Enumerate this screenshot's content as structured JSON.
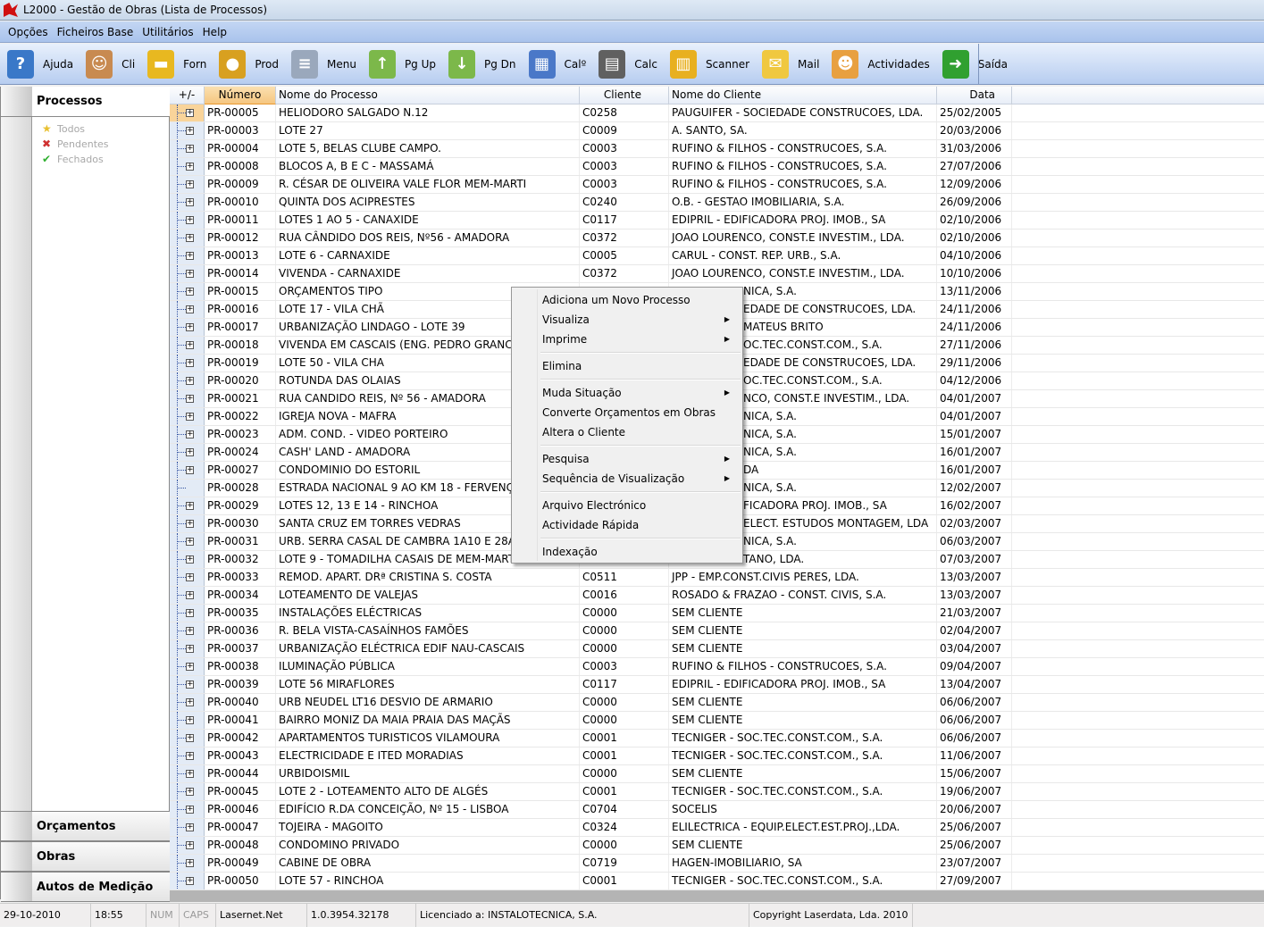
{
  "window": {
    "title": "L2000 - Gestão de Obras (Lista de Processos)"
  },
  "menu": [
    "Opções",
    "Ficheiros Base",
    "Utilitários",
    "Help"
  ],
  "toolbar": [
    {
      "label": "Ajuda",
      "icon": "help-book-icon",
      "color": "#3a78c8"
    },
    {
      "label": "Cli",
      "icon": "clients-icon",
      "color": "#c88a50"
    },
    {
      "label": "Forn",
      "icon": "truck-icon",
      "color": "#e8b820"
    },
    {
      "label": "Prod",
      "icon": "product-icon",
      "color": "#d8a020"
    },
    {
      "label": "Menu",
      "icon": "menu-document-icon",
      "color": "#9aa8bc"
    },
    {
      "label": "Pg Up",
      "icon": "page-up-icon",
      "color": "#7cb84a"
    },
    {
      "label": "Pg Dn",
      "icon": "page-down-icon",
      "color": "#7cb84a"
    },
    {
      "label": "Calº",
      "icon": "calendar-icon",
      "color": "#4a78c8"
    },
    {
      "label": "Calc",
      "icon": "calculator-icon",
      "color": "#606060"
    },
    {
      "label": "Scanner",
      "icon": "file-cabinet-icon",
      "color": "#e8b020"
    },
    {
      "label": "Mail",
      "icon": "mail-icon",
      "color": "#f0c840"
    },
    {
      "label": "Actividades",
      "icon": "worker-icon",
      "color": "#e8a040"
    },
    {
      "label": "Saída",
      "icon": "exit-door-icon",
      "color": "#30a030"
    }
  ],
  "sidebar": {
    "title": "Processos",
    "filters": [
      {
        "label": "Todos",
        "icon": "star-icon",
        "color": "#e8c030"
      },
      {
        "label": "Pendentes",
        "icon": "x-icon",
        "color": "#d03030"
      },
      {
        "label": "Fechados",
        "icon": "check-icon",
        "color": "#30b030"
      }
    ],
    "sections": [
      "Orçamentos",
      "Obras",
      "Autos de Medição"
    ]
  },
  "grid": {
    "columns": [
      "+/-",
      "Número",
      "Nome do Processo",
      "Cliente",
      "Nome do Cliente",
      "Data"
    ],
    "rows": [
      [
        "PR-00005",
        "HELIODORO SALGADO N.12",
        "C0258",
        "PAUGUIFER - SOCIEDADE CONSTRUCOES, LDA.",
        "25/02/2005"
      ],
      [
        "PR-00003",
        "LOTE 27",
        "C0009",
        "A. SANTO, SA.",
        "20/03/2006"
      ],
      [
        "PR-00004",
        "LOTE 5, BELAS CLUBE CAMPO.",
        "C0003",
        "RUFINO & FILHOS - CONSTRUCOES, S.A.",
        "31/03/2006"
      ],
      [
        "PR-00008",
        "BLOCOS A, B E C - MASSAMÁ",
        "C0003",
        "RUFINO & FILHOS - CONSTRUCOES, S.A.",
        "27/07/2006"
      ],
      [
        "PR-00009",
        "R. CÉSAR DE OLIVEIRA VALE FLOR MEM-MARTI",
        "C0003",
        "RUFINO & FILHOS - CONSTRUCOES, S.A.",
        "12/09/2006"
      ],
      [
        "PR-00010",
        "QUINTA DOS ACIPRESTES",
        "C0240",
        "O.B. - GESTAO IMOBILIARIA, S.A.",
        "26/09/2006"
      ],
      [
        "PR-00011",
        "LOTES 1 AO 5 - CANAXIDE",
        "C0117",
        "EDIPRIL - EDIFICADORA PROJ. IMOB., SA",
        "02/10/2006"
      ],
      [
        "PR-00012",
        "RUA CÂNDIDO DOS REIS, Nº56 - AMADORA",
        "C0372",
        "JOAO LOURENCO, CONST.E INVESTIM., LDA.",
        "02/10/2006"
      ],
      [
        "PR-00013",
        "LOTE 6 - CARNAXIDE",
        "C0005",
        "CARUL - CONST. REP. URB., S.A.",
        "04/10/2006"
      ],
      [
        "PR-00014",
        "VIVENDA - CARNAXIDE",
        "C0372",
        "JOAO LOURENCO, CONST.E INVESTIM., LDA.",
        "10/10/2006"
      ],
      [
        "PR-00015",
        "ORÇAMENTOS TIPO",
        "",
        "NICA, S.A.",
        "13/11/2006"
      ],
      [
        "PR-00016",
        "LOTE 17 - VILA CHÃ",
        "",
        "EDADE DE CONSTRUCOES, LDA.",
        "24/11/2006"
      ],
      [
        "PR-00017",
        "URBANIZAÇÃO LINDAGO - LOTE 39",
        "",
        "MATEUS BRITO",
        "24/11/2006"
      ],
      [
        "PR-00018",
        "VIVENDA EM CASCAIS (ENG. PEDRO GRANCH",
        "",
        "OC.TEC.CONST.COM., S.A.",
        "27/11/2006"
      ],
      [
        "PR-00019",
        "LOTE 50 - VILA CHA",
        "",
        "EDADE DE CONSTRUCOES, LDA.",
        "29/11/2006"
      ],
      [
        "PR-00020",
        "ROTUNDA DAS OLAIAS",
        "",
        "OC.TEC.CONST.COM., S.A.",
        "04/12/2006"
      ],
      [
        "PR-00021",
        "RUA CANDIDO REIS, Nº 56 - AMADORA",
        "",
        "NCO, CONST.E INVESTIM., LDA.",
        "04/01/2007"
      ],
      [
        "PR-00022",
        "IGREJA NOVA - MAFRA",
        "",
        "NICA, S.A.",
        "04/01/2007"
      ],
      [
        "PR-00023",
        "ADM. COND. - VIDEO PORTEIRO",
        "",
        "NICA, S.A.",
        "15/01/2007"
      ],
      [
        "PR-00024",
        "CASH' LAND - AMADORA",
        "",
        "NICA, S.A.",
        "16/01/2007"
      ],
      [
        "PR-00027",
        "CONDOMINIO DO ESTORIL",
        "",
        "DA",
        "16/01/2007"
      ],
      [
        "PR-00028",
        "ESTRADA NACIONAL 9 AO KM 18 - FERVENÇA",
        "",
        "NICA, S.A.",
        "12/02/2007"
      ],
      [
        "PR-00029",
        "LOTES 12, 13 E 14 - RINCHOA",
        "",
        "FICADORA PROJ. IMOB., SA",
        "16/02/2007"
      ],
      [
        "PR-00030",
        "SANTA CRUZ EM TORRES VEDRAS",
        "",
        "ELECT. ESTUDOS MONTAGEM, LDA",
        "02/03/2007"
      ],
      [
        "PR-00031",
        "URB. SERRA CASAL DE CAMBRA 1A10 E 28A3",
        "",
        "NICA, S.A.",
        "06/03/2007"
      ],
      [
        "PR-00032",
        "LOTE 9 - TOMADILHA CASAIS DE MEM-MARTI",
        "",
        "TANO, LDA.",
        "07/03/2007"
      ],
      [
        "PR-00033",
        "REMOD. APART. DRª CRISTINA S. COSTA",
        "C0511",
        "JPP - EMP.CONST.CIVIS PERES, LDA.",
        "13/03/2007"
      ],
      [
        "PR-00034",
        "LOTEAMENTO DE VALEJAS",
        "C0016",
        "ROSADO & FRAZAO - CONST. CIVIS, S.A.",
        "13/03/2007"
      ],
      [
        "PR-00035",
        "INSTALAÇÕES ELÉCTRICAS",
        "C0000",
        "SEM CLIENTE",
        "21/03/2007"
      ],
      [
        "PR-00036",
        "R. BELA VISTA-CASAÍNHOS FAMÕES",
        "C0000",
        "SEM CLIENTE",
        "02/04/2007"
      ],
      [
        "PR-00037",
        "URBANIZAÇÃO ELÉCTRICA EDIF NAU-CASCAIS",
        "C0000",
        "SEM CLIENTE",
        "03/04/2007"
      ],
      [
        "PR-00038",
        "ILUMINAÇÃO PÚBLICA",
        "C0003",
        "RUFINO & FILHOS - CONSTRUCOES, S.A.",
        "09/04/2007"
      ],
      [
        "PR-00039",
        "LOTE 56 MIRAFLORES",
        "C0117",
        "EDIPRIL - EDIFICADORA PROJ. IMOB., SA",
        "13/04/2007"
      ],
      [
        "PR-00040",
        "URB NEUDEL LT16 DESVIO DE ARMARIO",
        "C0000",
        "SEM CLIENTE",
        "06/06/2007"
      ],
      [
        "PR-00041",
        "BAIRRO MONIZ DA MAIA PRAIA DAS MAÇÃS",
        "C0000",
        "SEM CLIENTE",
        "06/06/2007"
      ],
      [
        "PR-00042",
        "APARTAMENTOS TURISTICOS VILAMOURA",
        "C0001",
        "TECNIGER - SOC.TEC.CONST.COM., S.A.",
        "06/06/2007"
      ],
      [
        "PR-00043",
        "ELECTRICIDADE E ITED MORADIAS",
        "C0001",
        "TECNIGER - SOC.TEC.CONST.COM., S.A.",
        "11/06/2007"
      ],
      [
        "PR-00044",
        "URBIDOISMIL",
        "C0000",
        "SEM CLIENTE",
        "15/06/2007"
      ],
      [
        "PR-00045",
        "LOTE 2 - LOTEAMENTO ALTO DE ALGÉS",
        "C0001",
        "TECNIGER - SOC.TEC.CONST.COM., S.A.",
        "19/06/2007"
      ],
      [
        "PR-00046",
        "EDIFÍCIO R.DA CONCEIÇÃO, Nº 15 - LISBOA",
        "C0704",
        "SOCELIS",
        "20/06/2007"
      ],
      [
        "PR-00047",
        "TOJEIRA - MAGOITO",
        "C0324",
        "ELILECTRICA - EQUIP.ELECT.EST.PROJ.,LDA.",
        "25/06/2007"
      ],
      [
        "PR-00048",
        "CONDOMINO PRIVADO",
        "C0000",
        "SEM CLIENTE",
        "25/06/2007"
      ],
      [
        "PR-00049",
        "CABINE DE OBRA",
        "C0719",
        "HAGEN-IMOBILIARIO, SA",
        "23/07/2007"
      ],
      [
        "PR-00050",
        "LOTE 57 - RINCHOA",
        "C0001",
        "TECNIGER - SOC.TEC.CONST.COM., S.A.",
        "27/09/2007"
      ]
    ]
  },
  "context_menu": [
    {
      "label": "Adiciona um Novo Processo",
      "submenu": false
    },
    {
      "label": "Visualiza",
      "submenu": true
    },
    {
      "label": "Imprime",
      "submenu": true
    },
    {
      "sep": true
    },
    {
      "label": "Elimina",
      "submenu": false
    },
    {
      "sep": true
    },
    {
      "label": "Muda Situação",
      "submenu": true
    },
    {
      "label": "Converte Orçamentos em Obras",
      "submenu": false
    },
    {
      "label": "Altera o Cliente",
      "submenu": false
    },
    {
      "sep": true
    },
    {
      "label": "Pesquisa",
      "submenu": true
    },
    {
      "label": "Sequência de Visualização",
      "submenu": true
    },
    {
      "sep": true
    },
    {
      "label": "Arquivo Electrónico",
      "submenu": false
    },
    {
      "label": "Actividade Rápida",
      "submenu": false
    },
    {
      "sep": true
    },
    {
      "label": "Indexação",
      "submenu": false
    }
  ],
  "statusbar": {
    "date": "29-10-2010",
    "time": "18:55",
    "num": "NUM",
    "caps": "CAPS",
    "product": "Lasernet.Net",
    "version": "1.0.3954.32178",
    "license": "Licenciado a: INSTALOTECNICA, S.A.",
    "copyright": "Copyright Laserdata, Lda. 2010"
  }
}
